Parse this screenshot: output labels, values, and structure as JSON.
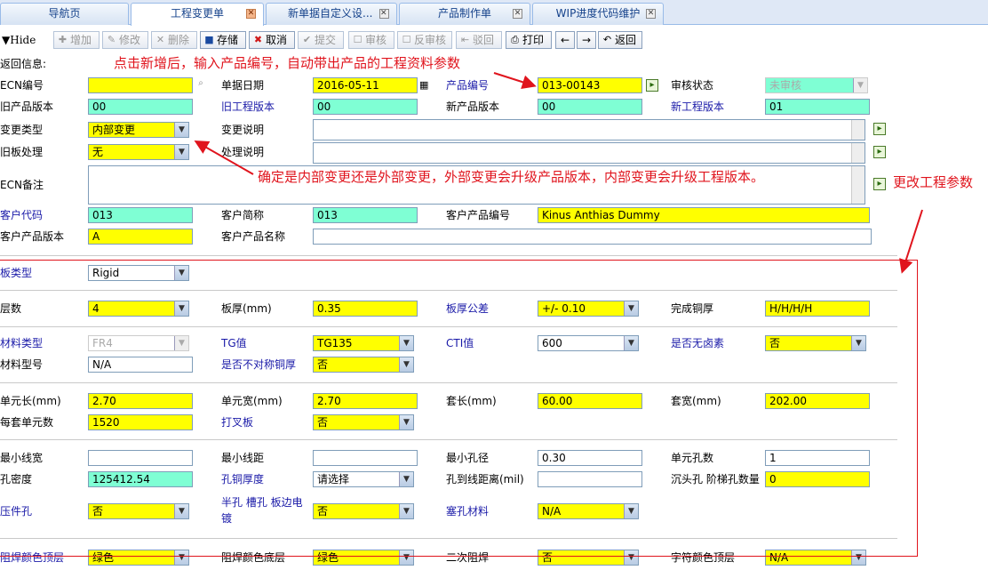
{
  "tabs": [
    {
      "label": "导航页"
    },
    {
      "label": "工程变更单"
    },
    {
      "label": "新单据自定义设..."
    },
    {
      "label": "产品制作单"
    },
    {
      "label": "WIP进度代码维护"
    }
  ],
  "toolbar": {
    "hide": "▼Hide",
    "add": "增加",
    "modify": "修改",
    "delete": "删除",
    "save": "存储",
    "cancel": "取消",
    "submit": "提交",
    "audit": "审核",
    "unaudit": "反审核",
    "reject": "驳回",
    "print": "打印",
    "back": "返回"
  },
  "info_label": "返回信息:",
  "annotations": {
    "top": "点击新增后，输入产品编号，自动带出产品的工程资料参数",
    "middle": "确定是内部变更还是外部变更，外部变更会升级产品版本，内部变更会升级工程版本。",
    "right": "更改工程参数"
  },
  "header": {
    "ecn_no": {
      "label": "ECN编号",
      "value": ""
    },
    "doc_date": {
      "label": "单据日期",
      "value": "2016-05-11"
    },
    "product_no": {
      "label": "产品编号",
      "value": "013-00143"
    },
    "audit_status": {
      "label": "审核状态",
      "value": "未审核"
    },
    "old_product_ver": {
      "label": "旧产品版本",
      "value": "00"
    },
    "old_eng_ver": {
      "label": "旧工程版本",
      "value": "00"
    },
    "new_product_ver": {
      "label": "新产品版本",
      "value": "00"
    },
    "new_eng_ver": {
      "label": "新工程版本",
      "value": "01"
    },
    "change_type": {
      "label": "变更类型",
      "value": "内部变更"
    },
    "change_desc": {
      "label": "变更说明",
      "value": ""
    },
    "old_board": {
      "label": "旧板处理",
      "value": "无"
    },
    "handle_desc": {
      "label": "处理说明",
      "value": ""
    },
    "ecn_note": {
      "label": "ECN备注",
      "value": ""
    },
    "customer_code": {
      "label": "客户代码",
      "value": "013"
    },
    "customer_short": {
      "label": "客户简称",
      "value": "013"
    },
    "customer_product_no": {
      "label": "客户产品编号",
      "value": "Kinus Anthias Dummy"
    },
    "customer_product_ver": {
      "label": "客户产品版本",
      "value": "A"
    },
    "customer_product_name": {
      "label": "客户产品名称",
      "value": ""
    }
  },
  "params": {
    "board_type": {
      "label": "板类型",
      "value": "Rigid"
    },
    "layers": {
      "label": "层数",
      "value": "4"
    },
    "thickness": {
      "label": "板厚(mm)",
      "value": "0.35"
    },
    "thickness_tol": {
      "label": "板厚公差",
      "value": "+/- 0.10"
    },
    "finish_copper": {
      "label": "完成铜厚",
      "value": "H/H/H/H"
    },
    "material_type": {
      "label": "材料类型",
      "value": "FR4"
    },
    "tg": {
      "label": "TG值",
      "value": "TG135"
    },
    "cti": {
      "label": "CTI值",
      "value": "600"
    },
    "halogen_free": {
      "label": "是否无卤素",
      "value": "否"
    },
    "material_model": {
      "label": "材料型号",
      "value": "N/A"
    },
    "asym_copper": {
      "label": "是否不对称铜厚",
      "value": "否"
    },
    "unit_len": {
      "label": "单元长(mm)",
      "value": "2.70"
    },
    "unit_wid": {
      "label": "单元宽(mm)",
      "value": "2.70"
    },
    "set_len": {
      "label": "套长(mm)",
      "value": "60.00"
    },
    "set_wid": {
      "label": "套宽(mm)",
      "value": "202.00"
    },
    "units_per_set": {
      "label": "每套单元数",
      "value": "1520"
    },
    "x_board": {
      "label": "打叉板",
      "value": "否"
    },
    "min_line_w": {
      "label": "最小线宽",
      "value": ""
    },
    "min_line_s": {
      "label": "最小线距",
      "value": ""
    },
    "min_hole": {
      "label": "最小孔径",
      "value": "0.30"
    },
    "unit_holes": {
      "label": "单元孔数",
      "value": "1"
    },
    "hole_density": {
      "label": "孔密度",
      "value": "125412.54"
    },
    "hole_copper": {
      "label": "孔铜厚度",
      "value": "请选择"
    },
    "hole_to_line": {
      "label": "孔到线距离(mil)",
      "value": ""
    },
    "countersink": {
      "label": "沉头孔 阶梯孔数量",
      "value": "0"
    },
    "press_fit": {
      "label": "压件孔",
      "value": "否"
    },
    "half_hole": {
      "label": "半孔 槽孔 板边电镀",
      "value": "否"
    },
    "plug_material": {
      "label": "塞孔材料",
      "value": "N/A"
    },
    "mask_top": {
      "label": "阻焊颜色顶层",
      "value": "绿色"
    },
    "mask_bottom": {
      "label": "阻焊颜色底层",
      "value": "绿色"
    },
    "second_mask": {
      "label": "二次阻焊",
      "value": "否"
    },
    "silk_top": {
      "label": "字符颜色顶层",
      "value": "N/A"
    }
  }
}
